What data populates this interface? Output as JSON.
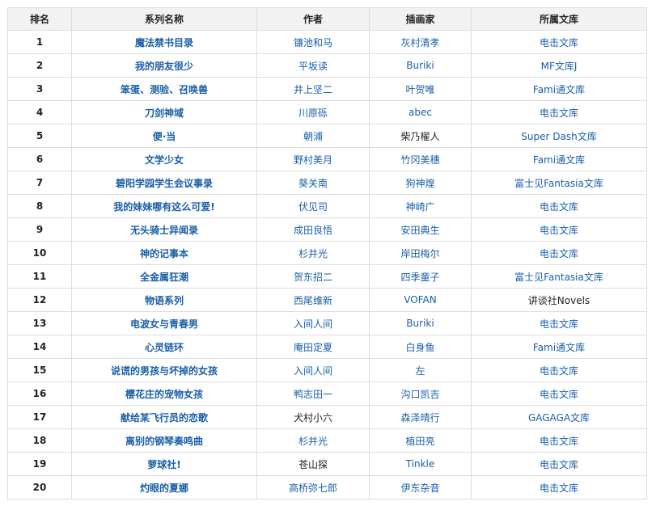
{
  "headers": [
    "排名",
    "系列名称",
    "作者",
    "插画家",
    "所属文库"
  ],
  "rows": [
    {
      "rank": "1",
      "title": "魔法禁书目录",
      "author": "镰池和马",
      "illustrator": "灰村清孝",
      "label": "电击文库",
      "author_link": true,
      "illustrator_link": true,
      "label_link": true
    },
    {
      "rank": "2",
      "title": "我的朋友很少",
      "author": "平坂读",
      "illustrator": "Buriki",
      "label": "MF文库J",
      "author_link": true,
      "illustrator_link": true,
      "label_link": true
    },
    {
      "rank": "3",
      "title": "笨蛋、测验、召唤兽",
      "author": "井上坚二",
      "illustrator": "叶贺唯",
      "label": "Fami通文库",
      "author_link": true,
      "illustrator_link": true,
      "label_link": true
    },
    {
      "rank": "4",
      "title": "刀剑神域",
      "author": "川原砾",
      "illustrator": "abec",
      "label": "电击文库",
      "author_link": true,
      "illustrator_link": true,
      "label_link": true
    },
    {
      "rank": "5",
      "title": "便·当",
      "author": "朝浦",
      "illustrator": "柴乃櫂人",
      "label": "Super Dash文库",
      "author_link": true,
      "illustrator_link": false,
      "label_link": true
    },
    {
      "rank": "6",
      "title": "文学少女",
      "author": "野村美月",
      "illustrator": "竹冈美穗",
      "label": "Fami通文库",
      "author_link": true,
      "illustrator_link": true,
      "label_link": true
    },
    {
      "rank": "7",
      "title": "碧阳学园学生会议事录",
      "author": "葵关南",
      "illustrator": "狗神煌",
      "label": "富士见Fantasia文库",
      "author_link": true,
      "illustrator_link": true,
      "label_link": true
    },
    {
      "rank": "8",
      "title": "我的妹妹哪有这么可爱!",
      "author": "伏见司",
      "illustrator": "神崎广",
      "label": "电击文库",
      "author_link": true,
      "illustrator_link": true,
      "label_link": true
    },
    {
      "rank": "9",
      "title": "无头骑士异闻录",
      "author": "成田良悟",
      "illustrator": "安田典生",
      "label": "电击文库",
      "author_link": true,
      "illustrator_link": true,
      "label_link": true
    },
    {
      "rank": "10",
      "title": "神的记事本",
      "author": "杉井光",
      "illustrator": "岸田梅尔",
      "label": "电击文库",
      "author_link": true,
      "illustrator_link": true,
      "label_link": true
    },
    {
      "rank": "11",
      "title": "全金属狂潮",
      "author": "贺东招二",
      "illustrator": "四季童子",
      "label": "富士见Fantasia文库",
      "author_link": true,
      "illustrator_link": true,
      "label_link": true
    },
    {
      "rank": "12",
      "title": "物语系列",
      "author": "西尾维新",
      "illustrator": "VOFAN",
      "label": "讲谈社Novels",
      "author_link": true,
      "illustrator_link": true,
      "label_link": false
    },
    {
      "rank": "13",
      "title": "电波女与青春男",
      "author": "入间人间",
      "illustrator": "Buriki",
      "label": "电击文库",
      "author_link": true,
      "illustrator_link": true,
      "label_link": true
    },
    {
      "rank": "14",
      "title": "心灵链环",
      "author": "庵田定夏",
      "illustrator": "白身鱼",
      "label": "Fami通文库",
      "author_link": true,
      "illustrator_link": true,
      "label_link": true
    },
    {
      "rank": "15",
      "title": "说谎的男孩与坏掉的女孩",
      "author": "入间人间",
      "illustrator": "左",
      "label": "电击文库",
      "author_link": true,
      "illustrator_link": true,
      "label_link": true
    },
    {
      "rank": "16",
      "title": "樱花庄的宠物女孩",
      "author": "鸭志田一",
      "illustrator": "沟口凯吉",
      "label": "电击文库",
      "author_link": true,
      "illustrator_link": true,
      "label_link": true
    },
    {
      "rank": "17",
      "title": "献给某飞行员的恋歌",
      "author": "犬村小六",
      "illustrator": "森泽晴行",
      "label": "GAGAGA文库",
      "author_link": false,
      "illustrator_link": true,
      "label_link": true
    },
    {
      "rank": "18",
      "title": "离别的钢琴奏鸣曲",
      "author": "杉井光",
      "illustrator": "植田亮",
      "label": "电击文库",
      "author_link": true,
      "illustrator_link": true,
      "label_link": true
    },
    {
      "rank": "19",
      "title": "萝球社!",
      "author": "苍山探",
      "illustrator": "Tinkle",
      "label": "电击文库",
      "author_link": false,
      "illustrator_link": true,
      "label_link": true
    },
    {
      "rank": "20",
      "title": "灼眼的夏娜",
      "author": "高桥弥七郎",
      "illustrator": "伊东杂音",
      "label": "电击文库",
      "author_link": true,
      "illustrator_link": true,
      "label_link": true
    }
  ],
  "colors": {
    "link": "#1a5fa8",
    "header_bg": "#f2f2f2",
    "border": "#dddddd",
    "text": "#222222"
  }
}
